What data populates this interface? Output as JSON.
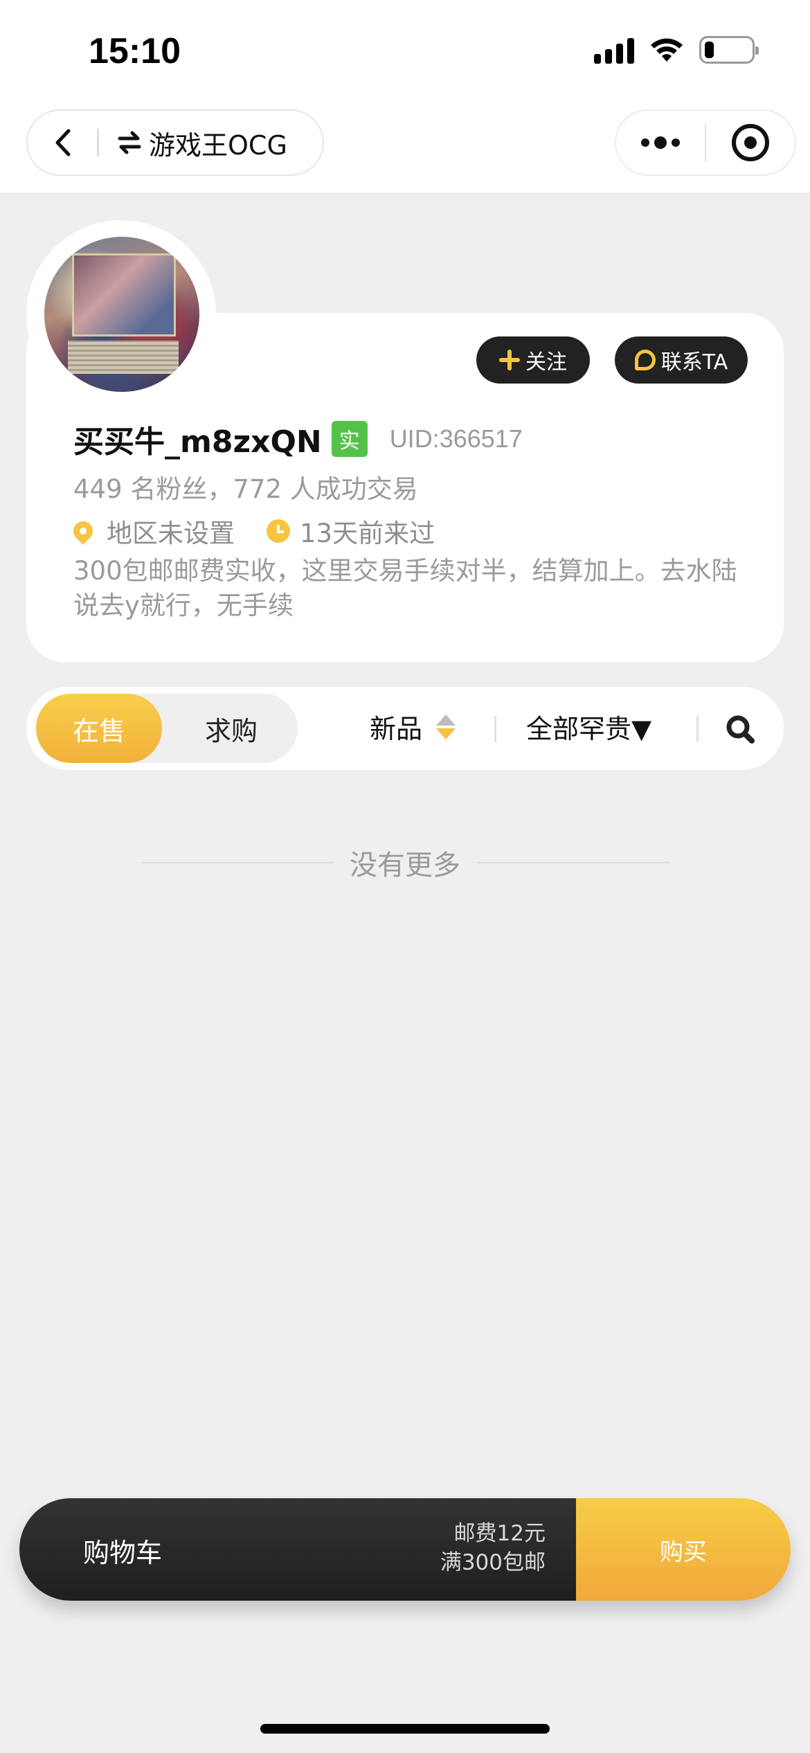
{
  "status_bar": {
    "time": "15:10"
  },
  "nav": {
    "title": "游戏王OCG"
  },
  "profile": {
    "follow_label": "关注",
    "contact_label": "联系TA",
    "username": "买买牛_m8zxQN",
    "real_badge": "实",
    "uid": "UID:366517",
    "stats": "449 名粉丝，772 人成功交易",
    "region": "地区未设置",
    "last_seen": "13天前来过",
    "bio": "300包邮邮费实收，这里交易手续对半，结算加上。去水陆说去y就行，无手续"
  },
  "filters": {
    "tab_selling": "在售",
    "tab_buying": "求购",
    "sort_label": "新品",
    "rarity_label": "全部罕贵▼"
  },
  "list": {
    "empty_text": "没有更多"
  },
  "cart": {
    "label": "购物车",
    "shipping_fee": "邮费12元",
    "free_shipping": "满300包邮",
    "buy_label": "购买"
  },
  "colors": {
    "accent": "#f5c542",
    "dark": "#222222",
    "badge_green": "#55c14a"
  }
}
